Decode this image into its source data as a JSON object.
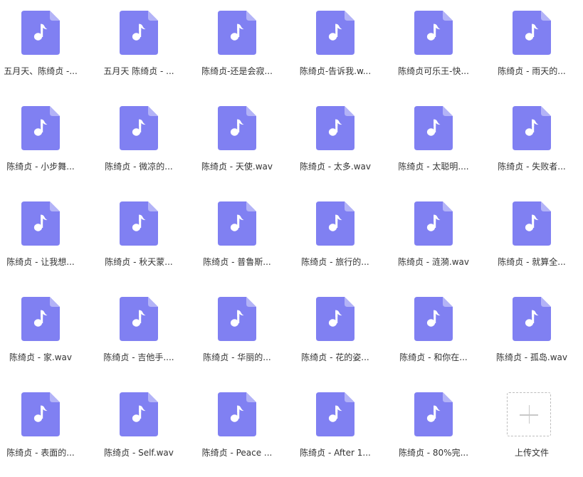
{
  "colors": {
    "file_icon": "#8080f2",
    "file_fold": "#b3b3f7",
    "note": "#ffffff",
    "label_text": "#333333",
    "upload_border": "#bdbdbd"
  },
  "files": [
    {
      "name": "五月天、陈绮贞 -...",
      "icon": "music-note-icon"
    },
    {
      "name": "五月天 陈绮贞 - ...",
      "icon": "music-note-icon"
    },
    {
      "name": "陈绮贞-还是会寂...",
      "icon": "music-note-icon"
    },
    {
      "name": "陈绮贞-告诉我.w...",
      "icon": "music-note-icon"
    },
    {
      "name": "陈绮贞可乐王-快...",
      "icon": "music-note-icon"
    },
    {
      "name": "陈绮贞 - 雨天的...",
      "icon": "music-note-icon"
    },
    {
      "name": "陈绮贞 - 小步舞...",
      "icon": "music-note-icon"
    },
    {
      "name": "陈绮贞 - 微凉的...",
      "icon": "music-note-icon"
    },
    {
      "name": "陈绮贞 - 天使.wav",
      "icon": "music-note-icon"
    },
    {
      "name": "陈绮贞 - 太多.wav",
      "icon": "music-note-icon"
    },
    {
      "name": "陈绮贞 - 太聪明....",
      "icon": "music-note-icon"
    },
    {
      "name": "陈绮贞 - 失败者...",
      "icon": "music-note-icon"
    },
    {
      "name": "陈绮贞 - 让我想...",
      "icon": "music-note-icon"
    },
    {
      "name": "陈绮贞 - 秋天蒙...",
      "icon": "music-note-icon"
    },
    {
      "name": "陈绮贞 - 普鲁斯...",
      "icon": "music-note-icon"
    },
    {
      "name": "陈绮贞 - 旅行的...",
      "icon": "music-note-icon"
    },
    {
      "name": "陈绮贞 - 涟漪.wav",
      "icon": "music-note-icon"
    },
    {
      "name": "陈绮贞 - 就算全...",
      "icon": "music-note-icon"
    },
    {
      "name": "陈绮贞 - 家.wav",
      "icon": "music-note-icon"
    },
    {
      "name": "陈绮贞 - 吉他手....",
      "icon": "music-note-icon"
    },
    {
      "name": "陈绮贞 - 华丽的...",
      "icon": "music-note-icon"
    },
    {
      "name": "陈绮贞 - 花的姿...",
      "icon": "music-note-icon"
    },
    {
      "name": "陈绮贞 - 和你在...",
      "icon": "music-note-icon"
    },
    {
      "name": "陈绮贞 - 孤岛.wav",
      "icon": "music-note-icon"
    },
    {
      "name": "陈绮贞 - 表面的...",
      "icon": "music-note-icon"
    },
    {
      "name": "陈绮贞 - Self.wav",
      "icon": "music-note-icon"
    },
    {
      "name": "陈绮贞 - Peace ...",
      "icon": "music-note-icon"
    },
    {
      "name": "陈绮贞 - After 1...",
      "icon": "music-note-icon"
    },
    {
      "name": "陈绮贞 - 80%完...",
      "icon": "music-note-icon"
    }
  ],
  "upload": {
    "label": "上传文件",
    "icon": "plus-icon"
  }
}
